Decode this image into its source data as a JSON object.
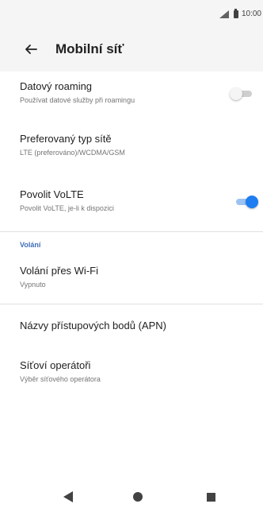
{
  "status": {
    "time": "10:00"
  },
  "toolbar": {
    "title": "Mobilní síť"
  },
  "settings": [
    {
      "title": "Datový roaming",
      "subtitle": "Používat datové služby při roamingu",
      "toggle": false
    },
    {
      "title": "Preferovaný typ sítě",
      "subtitle": "LTE (preferováno)/WCDMA/GSM"
    },
    {
      "title": "Povolit VoLTE",
      "subtitle": "Povolit VoLTE, je-li k dispozici",
      "toggle": true
    }
  ],
  "section": {
    "label": "Volání"
  },
  "calling": [
    {
      "title": "Volání přes Wi-Fi",
      "subtitle": "Vypnuto"
    }
  ],
  "network": [
    {
      "title": "Názvy přístupových bodů (APN)"
    },
    {
      "title": "Síťoví operátoři",
      "subtitle": "Výběr síťového operátora"
    }
  ],
  "colors": {
    "accent": "#1e7df0",
    "section": "#3f6fb9",
    "brand": "#e20074"
  },
  "icons": {
    "back": "arrow-back-icon",
    "signal": "signal-icon",
    "battery": "battery-icon"
  }
}
